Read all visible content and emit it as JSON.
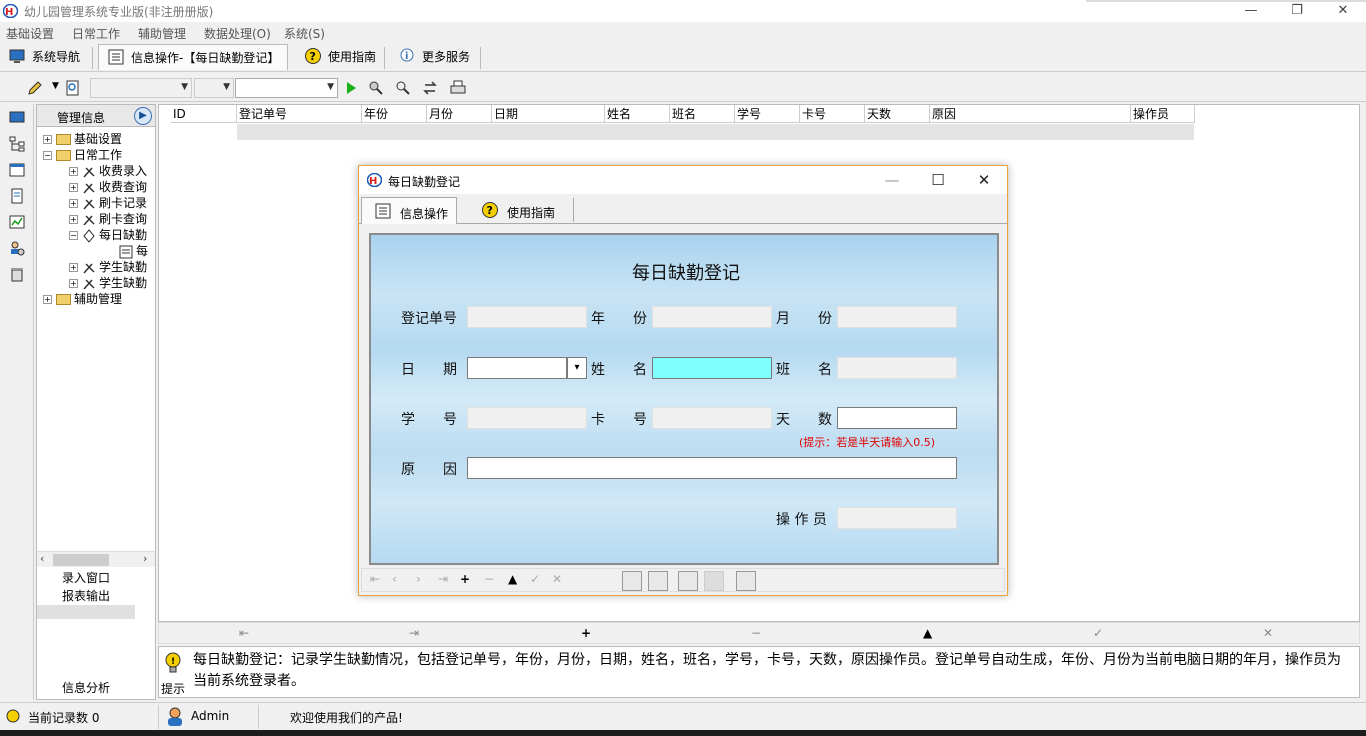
{
  "window": {
    "title": "幼儿园管理系统专业版(非注册册版)"
  },
  "menu": [
    "基础设置",
    "日常工作",
    "辅助管理",
    "数据处理(O)",
    "系统(S)"
  ],
  "tabs": [
    {
      "label": "系统导航",
      "icon": "monitor-icon"
    },
    {
      "label": "信息操作-【每日缺勤登记】",
      "icon": "form-icon"
    },
    {
      "label": "使用指南",
      "icon": "help-icon"
    },
    {
      "label": "更多服务",
      "icon": "service-icon"
    }
  ],
  "nav": {
    "header": "管理信息",
    "tree": [
      "基础设置",
      "日常工作",
      "收费录入",
      "收费查询",
      "刷卡记录",
      "刷卡查询",
      "每日缺勤",
      "每",
      "学生缺勤",
      "学生缺勤",
      "辅助管理"
    ],
    "buttons": [
      "录入窗口",
      "报表输出",
      "信息分析"
    ]
  },
  "grid": {
    "columns": [
      "ID",
      "登记单号",
      "年份",
      "月份",
      "日期",
      "姓名",
      "班名",
      "学号",
      "卡号",
      "天数",
      "原因",
      "操作员"
    ]
  },
  "tip": {
    "label": "提示",
    "text": "每日缺勤登记：记录学生缺勤情况，包括登记单号，年份，月份，日期，姓名，班名，学号，卡号，天数，原因操作员。登记单号自动生成，年份、月份为当前电脑日期的年月，操作员为当前系统登录者。"
  },
  "status": {
    "record_count": "当前记录数 0",
    "user": "Admin",
    "welcome": "欢迎使用我们的产品!"
  },
  "dialog": {
    "title": "每日缺勤登记",
    "tabs": [
      "信息操作",
      "使用指南"
    ],
    "form_title": "每日缺勤登记",
    "labels": {
      "reg_no": "登记单号",
      "year": "年　　份",
      "month": "月　　份",
      "date": "日　　期",
      "name": "姓　　名",
      "class": "班　　名",
      "student_no": "学　　号",
      "card_no": "卡　　号",
      "days": "天　　数",
      "reason": "原　　因",
      "operator": "操 作 员"
    },
    "hint": "(提示：若是半天请输入0.5)"
  },
  "colors": {
    "highlight_field": "#80ffff",
    "hint_red": "#e00000",
    "dialog_border": "#e8a33c"
  }
}
